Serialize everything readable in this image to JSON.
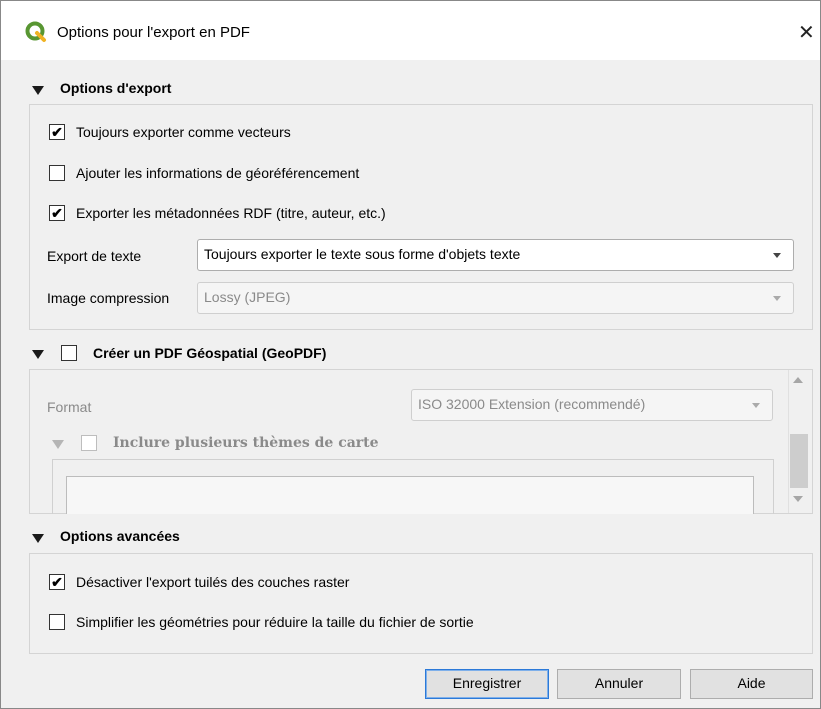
{
  "window": {
    "title": "Options pour l'export en PDF",
    "close_glyph": "✕",
    "icon": "qgis-logo-icon"
  },
  "export_options": {
    "title": "Options d'export",
    "checkboxes": [
      {
        "label": "Toujours exporter comme vecteurs",
        "checked": true
      },
      {
        "label": "Ajouter les informations de géoréférencement",
        "checked": false
      },
      {
        "label": "Exporter les métadonnées RDF (titre, auteur, etc.)",
        "checked": true
      }
    ],
    "text_export": {
      "label": "Export de texte",
      "value": "Toujours exporter le texte sous forme d'objets texte"
    },
    "image_compression": {
      "label": "Image compression",
      "value": "Lossy (JPEG)"
    }
  },
  "geopdf": {
    "title": "Créer un PDF Géospatial (GeoPDF)",
    "checked": false,
    "format": {
      "label": "Format",
      "value": "ISO 32000 Extension (recommendé)"
    },
    "themes": {
      "label": "Inclure plusieurs thèmes de carte",
      "checked": false
    }
  },
  "advanced": {
    "title": "Options avancées",
    "checkboxes": [
      {
        "label": "Désactiver l'export tuilés des couches raster",
        "checked": true
      },
      {
        "label": "Simplifier les géométries pour réduire la taille du fichier de sortie",
        "checked": false
      }
    ]
  },
  "buttons": {
    "save": "Enregistrer",
    "cancel": "Annuler",
    "help": "Aide"
  },
  "checkmark": "✔"
}
